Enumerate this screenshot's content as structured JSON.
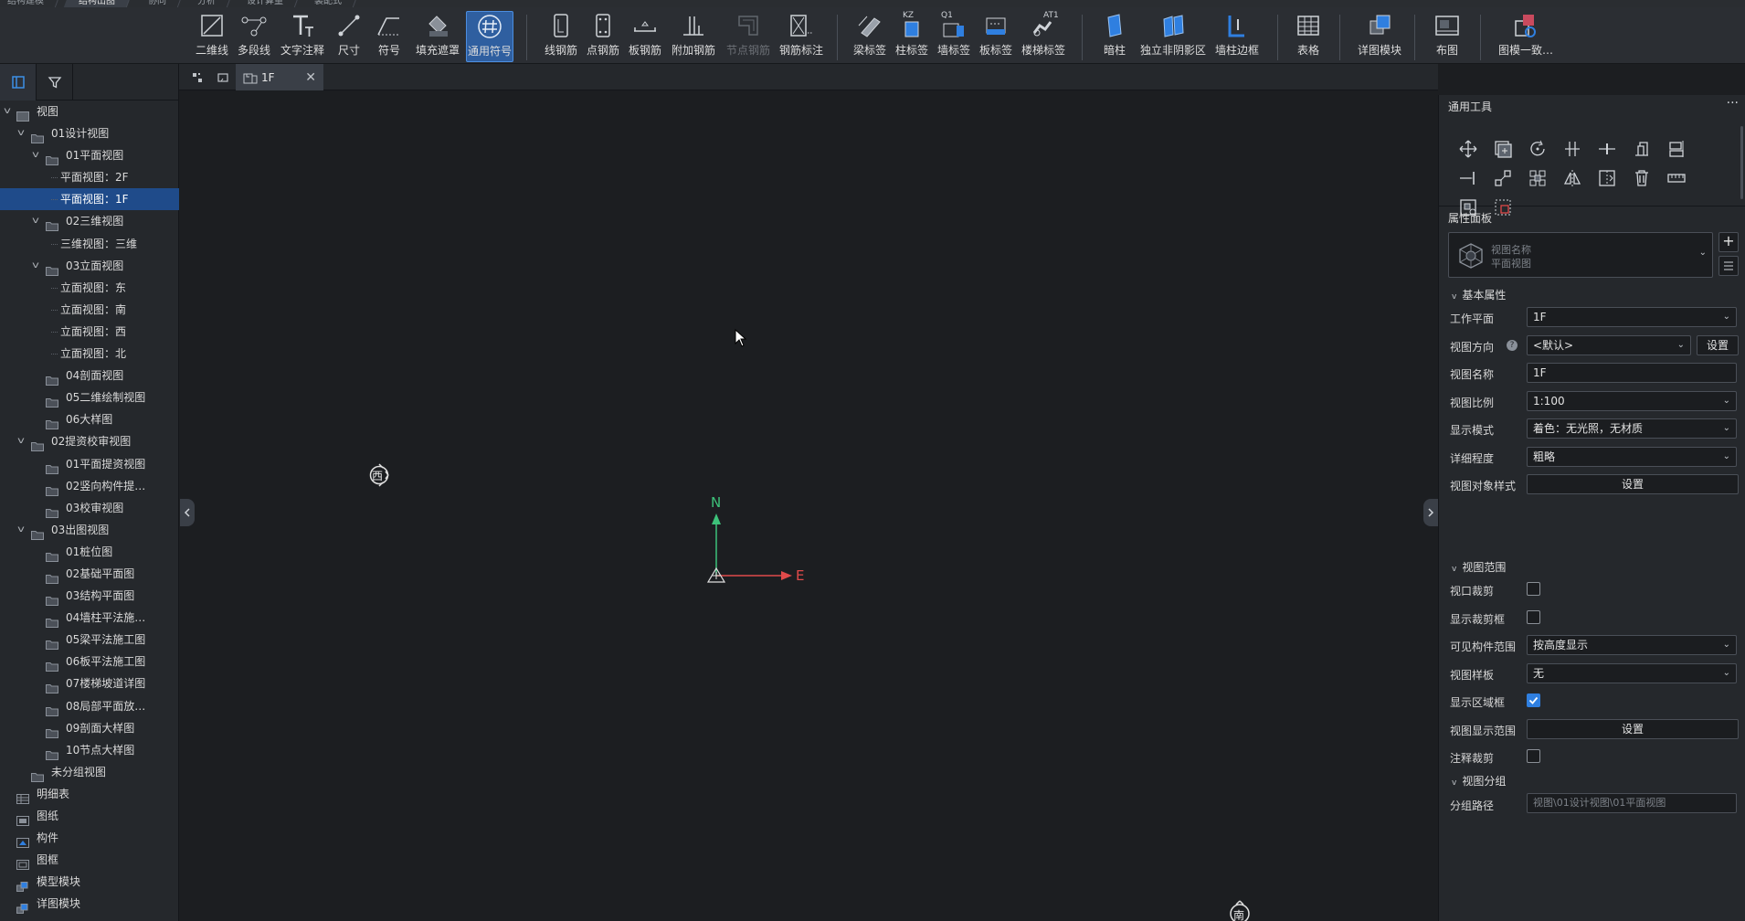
{
  "menu_tabs": [
    "结构建模",
    "结构出图",
    "协同",
    "分析",
    "设计算量",
    "装配式"
  ],
  "ribbon": {
    "group1": [
      {
        "label": "二维线",
        "icon": "2d-line-icon"
      },
      {
        "label": "多段线",
        "icon": "polyline-icon"
      },
      {
        "label": "文字注释",
        "icon": "text-annotation-icon"
      },
      {
        "label": "尺寸",
        "icon": "dimension-icon"
      },
      {
        "label": "符号",
        "icon": "symbol-icon"
      },
      {
        "label": "填充遮罩",
        "icon": "fill-mask-icon"
      },
      {
        "label": "通用符号",
        "icon": "general-symbol-icon"
      }
    ],
    "group2": [
      {
        "label": "线钢筋",
        "icon": "line-rebar-icon"
      },
      {
        "label": "点钢筋",
        "icon": "point-rebar-icon"
      },
      {
        "label": "板钢筋",
        "icon": "slab-rebar-icon"
      },
      {
        "label": "附加钢筋",
        "icon": "additional-rebar-icon"
      },
      {
        "label": "节点钢筋",
        "icon": "node-rebar-icon"
      },
      {
        "label": "钢筋标注",
        "icon": "rebar-annotation-icon"
      }
    ],
    "group3": [
      {
        "label": "梁标签",
        "icon": "beam-tag-icon"
      },
      {
        "label": "柱标签",
        "icon": "column-tag-icon"
      },
      {
        "label": "墙标签",
        "icon": "wall-tag-icon"
      },
      {
        "label": "板标签",
        "icon": "slab-tag-icon"
      },
      {
        "label": "楼梯标签",
        "icon": "stair-tag-icon"
      }
    ],
    "group4": [
      {
        "label": "暗柱",
        "icon": "hidden-column-icon"
      },
      {
        "label": "独立非阴影区",
        "icon": "non-shadow-area-icon"
      },
      {
        "label": "墙柱边框",
        "icon": "wall-column-border-icon"
      }
    ],
    "tag_texts": {
      "column": "KZ",
      "wall": "Q1",
      "stair": "AT1"
    },
    "table": "表格",
    "detail_module": "详图模块",
    "layout": "布图",
    "image_model": "图模一致…"
  },
  "left_panel": {
    "tree": [
      {
        "label": "视图",
        "level": 0,
        "arrow": "v",
        "icon": "view"
      },
      {
        "label": "01设计视图",
        "level": 1,
        "arrow": "v",
        "icon": "folder"
      },
      {
        "label": "01平面视图",
        "level": 2,
        "arrow": "v",
        "icon": "folder"
      },
      {
        "label": "平面视图：2F",
        "level": 3,
        "arrow": "",
        "icon": ""
      },
      {
        "label": "平面视图：1F",
        "level": 3,
        "arrow": "",
        "icon": "",
        "selected": true
      },
      {
        "label": "02三维视图",
        "level": 2,
        "arrow": "v",
        "icon": "folder"
      },
      {
        "label": "三维视图：三维",
        "level": 3,
        "arrow": "",
        "icon": ""
      },
      {
        "label": "03立面视图",
        "level": 2,
        "arrow": "v",
        "icon": "folder"
      },
      {
        "label": "立面视图：东",
        "level": 3,
        "arrow": "",
        "icon": ""
      },
      {
        "label": "立面视图：南",
        "level": 3,
        "arrow": "",
        "icon": ""
      },
      {
        "label": "立面视图：西",
        "level": 3,
        "arrow": "",
        "icon": ""
      },
      {
        "label": "立面视图：北",
        "level": 3,
        "arrow": "",
        "icon": ""
      },
      {
        "label": "04剖面视图",
        "level": 2,
        "arrow": "",
        "icon": "folder"
      },
      {
        "label": "05二维绘制视图",
        "level": 2,
        "arrow": "",
        "icon": "folder"
      },
      {
        "label": "06大样图",
        "level": 2,
        "arrow": "",
        "icon": "folder"
      },
      {
        "label": "02提资校审视图",
        "level": 1,
        "arrow": "v",
        "icon": "folder"
      },
      {
        "label": "01平面提资视图",
        "level": 2,
        "arrow": "",
        "icon": "folder"
      },
      {
        "label": "02竖向构件提…",
        "level": 2,
        "arrow": "",
        "icon": "folder"
      },
      {
        "label": "03校审视图",
        "level": 2,
        "arrow": "",
        "icon": "folder"
      },
      {
        "label": "03出图视图",
        "level": 1,
        "arrow": "v",
        "icon": "folder"
      },
      {
        "label": "01桩位图",
        "level": 2,
        "arrow": "",
        "icon": "folder"
      },
      {
        "label": "02基础平面图",
        "level": 2,
        "arrow": "",
        "icon": "folder"
      },
      {
        "label": "03结构平面图",
        "level": 2,
        "arrow": "",
        "icon": "folder"
      },
      {
        "label": "04墙柱平法施…",
        "level": 2,
        "arrow": "",
        "icon": "folder"
      },
      {
        "label": "05梁平法施工图",
        "level": 2,
        "arrow": "",
        "icon": "folder"
      },
      {
        "label": "06板平法施工图",
        "level": 2,
        "arrow": "",
        "icon": "folder"
      },
      {
        "label": "07楼梯坡道详图",
        "level": 2,
        "arrow": "",
        "icon": "folder"
      },
      {
        "label": "08局部平面放…",
        "level": 2,
        "arrow": "",
        "icon": "folder"
      },
      {
        "label": "09剖面大样图",
        "level": 2,
        "arrow": "",
        "icon": "folder"
      },
      {
        "label": "10节点大样图",
        "level": 2,
        "arrow": "",
        "icon": "folder"
      },
      {
        "label": "未分组视图",
        "level": 1,
        "arrow": "",
        "icon": "folder"
      },
      {
        "label": "明细表",
        "level": 0.5,
        "arrow": "",
        "icon": "table"
      },
      {
        "label": "图纸",
        "level": 0.5,
        "arrow": "",
        "icon": "sheet"
      },
      {
        "label": "构件",
        "level": 0.5,
        "arrow": "",
        "icon": "component"
      },
      {
        "label": "图框",
        "level": 0.5,
        "arrow": "",
        "icon": "frame"
      },
      {
        "label": "模型模块",
        "level": 0.5,
        "arrow": "",
        "icon": "module"
      },
      {
        "label": "详图模块",
        "level": 0.5,
        "arrow": "",
        "icon": "module"
      }
    ]
  },
  "doc_tab": {
    "label": "1F"
  },
  "canvas": {
    "compass_n": "N",
    "compass_e": "E",
    "west_marker": "西",
    "south_marker": "南"
  },
  "right_panel": {
    "tools_title": "通用工具",
    "props_title": "属性面板",
    "type_selector": {
      "line1": "视图名称",
      "line2": "平面视图"
    },
    "basic_section": "基本属性",
    "props": [
      {
        "label": "工作平面",
        "value": "1F",
        "type": "select"
      },
      {
        "label": "视图方向",
        "value": "<默认>",
        "type": "select",
        "button": "设置"
      },
      {
        "label": "视图名称",
        "value": "1F",
        "type": "text"
      },
      {
        "label": "视图比例",
        "value": "1:100",
        "type": "select"
      },
      {
        "label": "显示模式",
        "value": "着色：无光照，无材质",
        "type": "select"
      },
      {
        "label": "详细程度",
        "value": "粗略",
        "type": "select"
      },
      {
        "label": "视图对象样式",
        "value": "设置",
        "type": "button"
      }
    ],
    "range_section": "视图范围",
    "range_props": [
      {
        "label": "视口裁剪",
        "type": "check",
        "checked": false
      },
      {
        "label": "显示裁剪框",
        "type": "check",
        "checked": false
      },
      {
        "label": "可见构件范围",
        "value": "按高度显示",
        "type": "select"
      },
      {
        "label": "视图样板",
        "value": "无",
        "type": "select"
      },
      {
        "label": "显示区域框",
        "type": "check",
        "checked": true
      },
      {
        "label": "视图显示范围",
        "value": "设置",
        "type": "button"
      },
      {
        "label": "注释裁剪",
        "type": "check",
        "checked": false
      }
    ],
    "group_section": "视图分组",
    "group_path_label": "分组路径",
    "group_path_value": "视图\\01设计视图\\01平面视图"
  }
}
